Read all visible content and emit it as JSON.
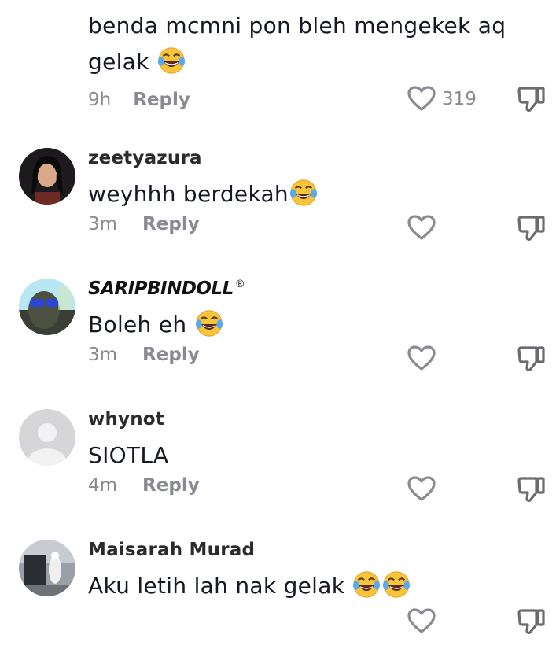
{
  "comments": [
    {
      "username": "",
      "text": "benda mcmni pon bleh mengekek aq gelak",
      "emojis": 1,
      "time": "9h",
      "reply_label": "Reply",
      "likes": "319"
    },
    {
      "username": "zeetyazura",
      "text": "weyhhh berdekah",
      "emojis": 1,
      "time": "3m",
      "reply_label": "Reply",
      "likes": ""
    },
    {
      "username": "SARIPBINDOLL",
      "username_mark": "®",
      "text": "Boleh eh ",
      "emojis": 1,
      "time": "3m",
      "reply_label": "Reply",
      "likes": ""
    },
    {
      "username": "whynot",
      "text": "SIOTLA",
      "emojis": 0,
      "time": "4m",
      "reply_label": "Reply",
      "likes": ""
    },
    {
      "username": "Maisarah Murad",
      "text": "Aku letih lah nak gelak ",
      "emojis": 2,
      "time": "",
      "reply_label": "",
      "likes": ""
    }
  ],
  "icons": {
    "like": "heart-outline-icon",
    "dislike": "thumbs-down-icon",
    "emoji": "face-with-tears-of-joy-icon"
  },
  "colors": {
    "text": "#161823",
    "muted": "#8a8b91",
    "background": "#ffffff"
  }
}
